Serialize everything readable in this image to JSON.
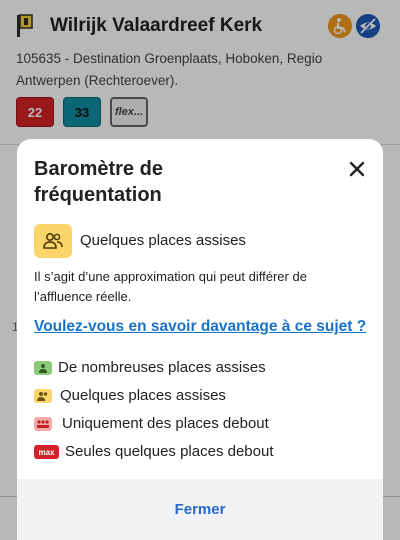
{
  "stop": {
    "title": "Wilrijk Valaardreef Kerk",
    "description": "105635 - Destination Groenplaats, Hoboken, Regio Antwerpen (Rechteroever).",
    "lines": [
      {
        "label": "22",
        "color": "#d32228"
      },
      {
        "label": "33",
        "color": "#0f8fa0"
      },
      {
        "label": "flex...",
        "color": "#eef0f2"
      }
    ],
    "side_text": "1"
  },
  "modal": {
    "title": "Baromètre de fréquentation",
    "current": {
      "label": "Quelques places assises",
      "color": "#fbd56a"
    },
    "note": "Il s’agit d’une approximation qui peut différer de l’affluence réelle.",
    "link": "Voulez-vous en savoir davantage à ce sujet ?",
    "legend": [
      {
        "label": "De nombreuses places assises",
        "color": "#8bc877"
      },
      {
        "label": "Quelques places assises",
        "color": "#fbd56a"
      },
      {
        "label": "Uniquement des places debout",
        "color": "#f5a9a9"
      },
      {
        "label": "Seules quelques places debout",
        "color": "#d32228",
        "icon_text": "max"
      }
    ],
    "close_label": "Fermer"
  }
}
